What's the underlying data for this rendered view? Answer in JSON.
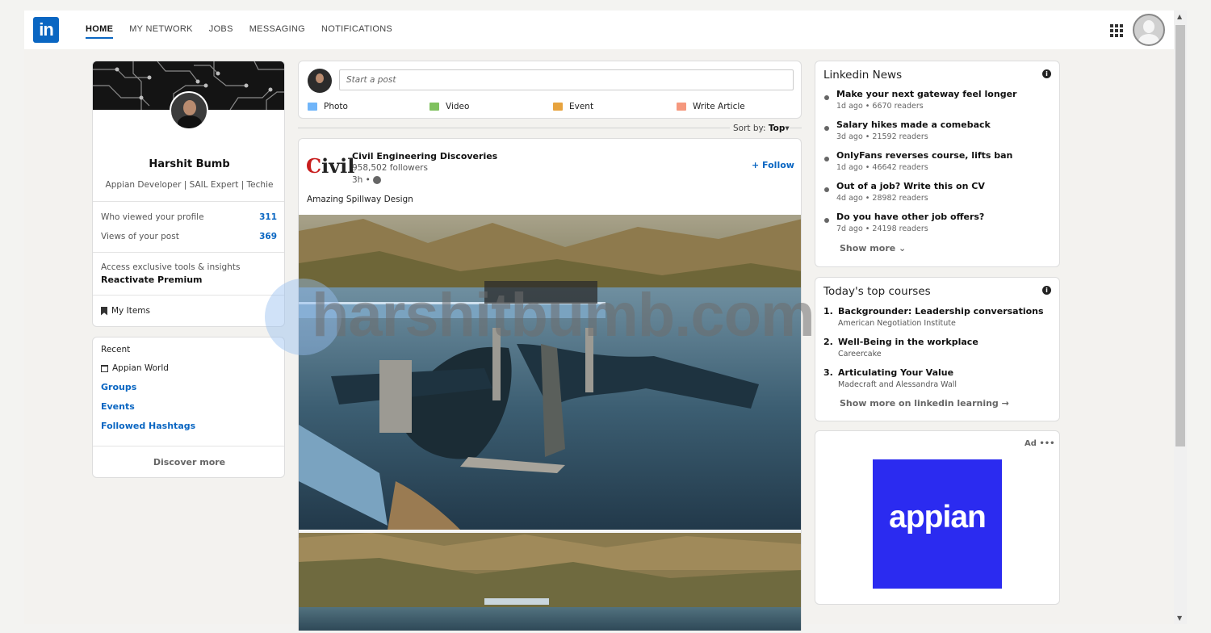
{
  "topbar": {
    "logo_text": "in",
    "nav": [
      "HOME",
      "MY NETWORK",
      "JOBS",
      "MESSAGING",
      "NOTIFICATIONS"
    ]
  },
  "profile": {
    "name": "Harshit Bumb",
    "headline": "Appian Developer | SAIL Expert | Techie",
    "stats": [
      {
        "label": "Who viewed your profile",
        "value": "311"
      },
      {
        "label": "Views of your post",
        "value": "369"
      }
    ],
    "premium_label": "Access exclusive tools & insights",
    "premium_cta": "Reactivate Premium",
    "my_items": "My Items"
  },
  "recent": {
    "title": "Recent",
    "item": "Appian World",
    "links": [
      "Groups",
      "Events",
      "Followed Hashtags"
    ],
    "discover": "Discover more"
  },
  "share": {
    "placeholder": "Start a post",
    "actions": [
      {
        "label": "Photo",
        "icon": "photo-icon",
        "color": "#70b5f9"
      },
      {
        "label": "Video",
        "icon": "video-icon",
        "color": "#7fc15e"
      },
      {
        "label": "Event",
        "icon": "event-icon",
        "color": "#e7a33e"
      },
      {
        "label": "Write Article",
        "icon": "article-icon",
        "color": "#f5987e"
      }
    ]
  },
  "sort": {
    "label": "Sort by:",
    "value": "Top"
  },
  "post": {
    "logo_text": "Civil",
    "company": "Civil Engineering Discoveries",
    "followers": "958,502 followers",
    "time": "3h •",
    "follow": "+ Follow",
    "text": "Amazing Spillway Design"
  },
  "watermark": "harshitbumb.com",
  "news": {
    "title": "Linkedin News",
    "items": [
      {
        "headline": "Make your next gateway feel longer",
        "meta": "1d ago • 6670 readers"
      },
      {
        "headline": "Salary hikes made a comeback",
        "meta": "3d ago • 21592 readers"
      },
      {
        "headline": "OnlyFans reverses course, lifts ban",
        "meta": "1d ago • 46642 readers"
      },
      {
        "headline": "Out of a job? Write this on CV",
        "meta": "4d ago • 28982 readers"
      },
      {
        "headline": "Do you have other job offers?",
        "meta": "7d ago • 24198 readers"
      }
    ],
    "show_more": "Show more ⌄"
  },
  "courses": {
    "title": "Today's top courses",
    "items": [
      {
        "num": "1.",
        "title": "Backgrounder: Leadership conversations",
        "source": "American Negotiation Institute"
      },
      {
        "num": "2.",
        "title": "Well-Being in the workplace",
        "source": "Careercake"
      },
      {
        "num": "3.",
        "title": "Articulating Your Value",
        "source": "Madecraft and Alessandra Wall"
      }
    ],
    "show_more": "Show more on linkedin learning →"
  },
  "ad": {
    "label": "Ad •••",
    "brand": "appian",
    "brand_color": "#2b2bf0"
  },
  "colors": {
    "accent": "#0a66c2",
    "background": "#f3f2ef"
  }
}
